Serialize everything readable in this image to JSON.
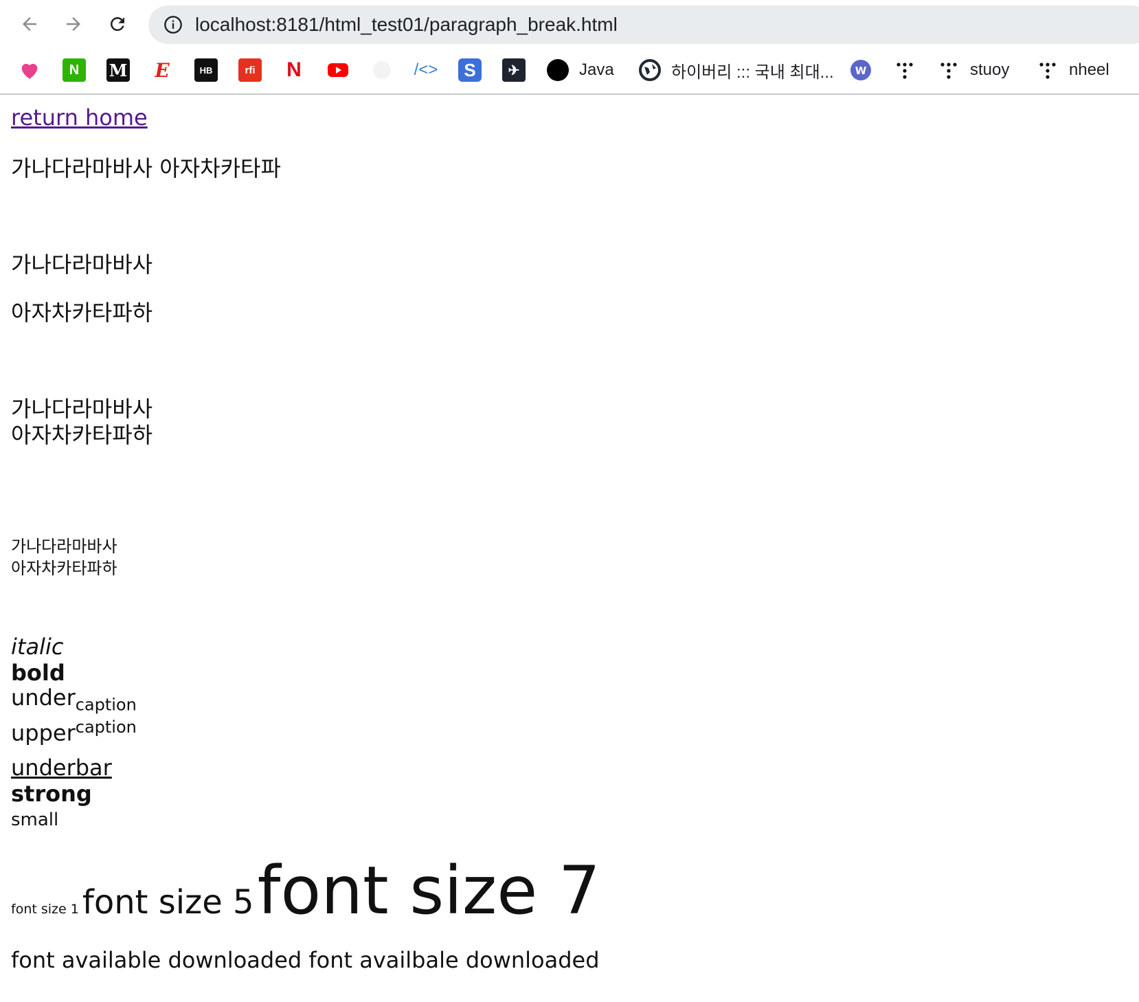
{
  "browser": {
    "url": "localhost:8181/html_test01/paragraph_break.html",
    "bookmarks": [
      {
        "label": "",
        "icon": "heart-icon"
      },
      {
        "label": "",
        "icon": "n-icon"
      },
      {
        "label": "",
        "icon": "m-icon"
      },
      {
        "label": "",
        "icon": "e-icon"
      },
      {
        "label": "",
        "icon": "hb-icon"
      },
      {
        "label": "",
        "icon": "rfi-icon"
      },
      {
        "label": "",
        "icon": "netflix-icon"
      },
      {
        "label": "",
        "icon": "youtube-icon"
      },
      {
        "label": "",
        "icon": "github-icon"
      },
      {
        "label": "",
        "icon": "code-icon"
      },
      {
        "label": "",
        "icon": "s-icon"
      },
      {
        "label": "",
        "icon": "bird-icon"
      },
      {
        "label": "Java",
        "icon": "circle-icon"
      },
      {
        "label": "하이버리 ::: 국내 최대...",
        "icon": "globe-icon"
      },
      {
        "label": "",
        "icon": "w-icon"
      },
      {
        "label": "",
        "icon": "dots-icon"
      },
      {
        "label": "stuoy",
        "icon": "dots-icon"
      },
      {
        "label": "nheel",
        "icon": "dots-icon"
      }
    ]
  },
  "page": {
    "link": "return home",
    "line1": "가나다라마바사 아자차카타파",
    "p2a": "가나다라마바사",
    "p2b": "아자차카타파하",
    "br_a": "가나다라마바사",
    "br_b": "아자차카타파하",
    "small_a": "가나다라마바사",
    "small_b": "아자차카타파하",
    "italic": "italic",
    "bold": "bold",
    "under": "under",
    "sub": "caption",
    "upper": "upper",
    "sup": "caption",
    "underbar": "underbar",
    "strong": "strong",
    "small": "small",
    "fs1": "font size 1",
    "fs5": "font size 5",
    "fs7": "font size 7",
    "last": "font available downloaded font availbale downloaded"
  }
}
